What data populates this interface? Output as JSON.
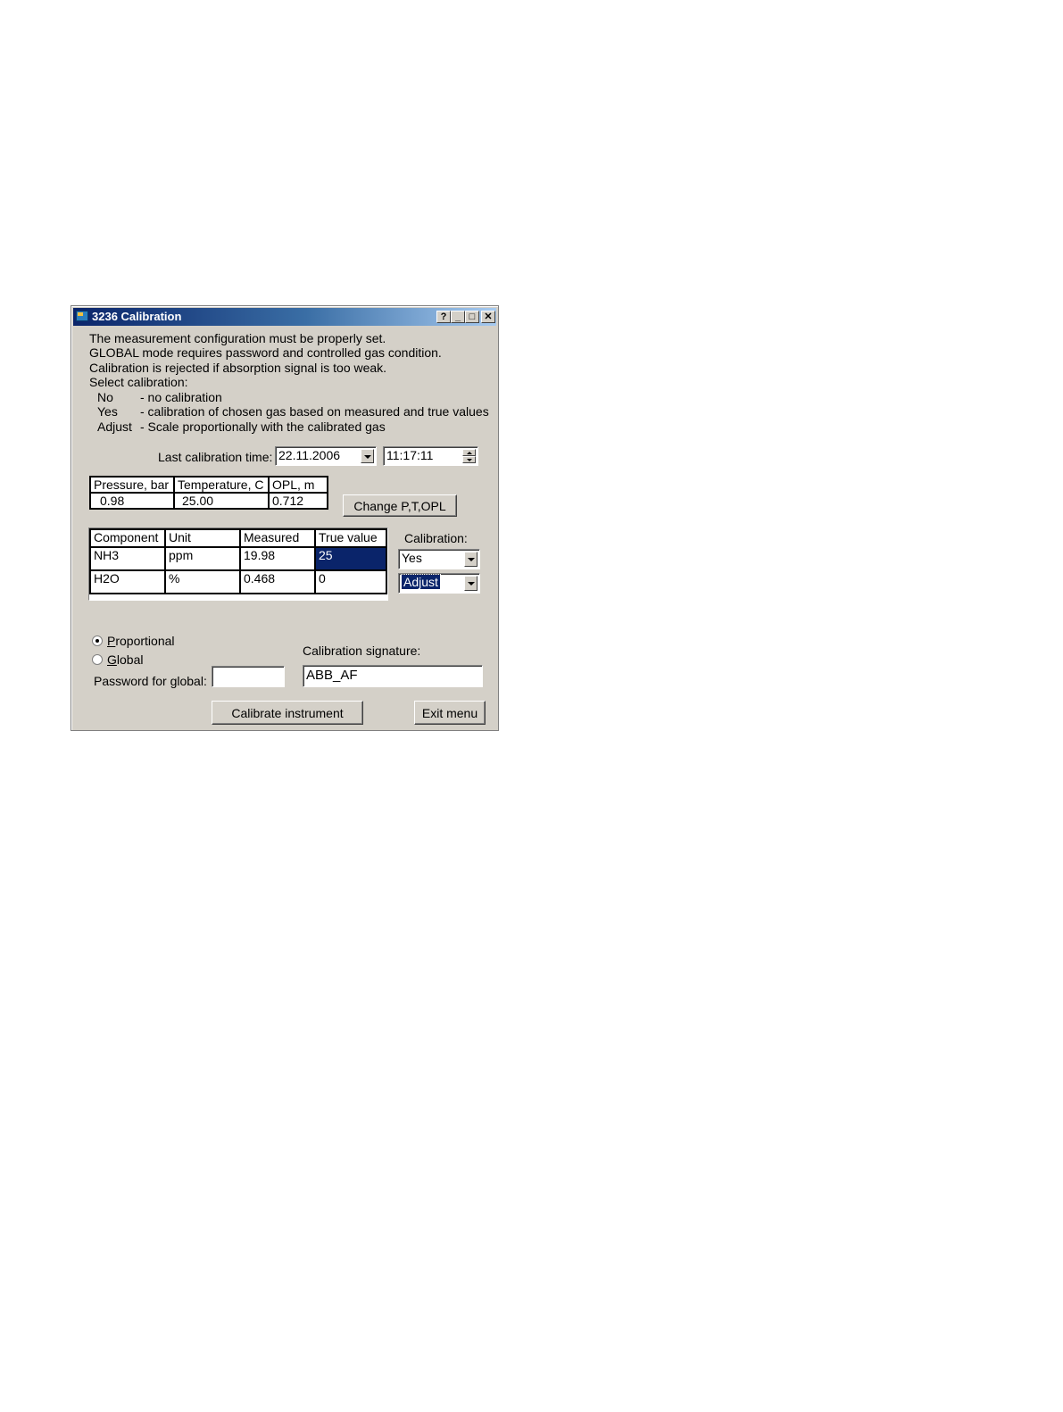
{
  "window": {
    "title": "3236 Calibration"
  },
  "info": {
    "line1": "The measurement configuration must be properly set.",
    "line2": "GLOBAL mode requires password and controlled gas condition.",
    "line3": "Calibration is rejected if absorption signal is too weak.",
    "line4": "Select calibration:",
    "options": [
      {
        "key": "No",
        "desc": "- no calibration"
      },
      {
        "key": "Yes",
        "desc": "- calibration of chosen gas based on measured and true values"
      },
      {
        "key": "Adjust",
        "desc": "- Scale proportionally with the calibrated gas"
      }
    ]
  },
  "last_calibration": {
    "label": "Last calibration time:",
    "date": "22.11.2006",
    "time": "11:17:11"
  },
  "ptopl": {
    "headers": [
      "Pressure, bar",
      "Temperature, C",
      "OPL, m"
    ],
    "values": [
      "0.98",
      "25.00",
      "0.712"
    ],
    "button": "Change P,T,OPL"
  },
  "components": {
    "headers": [
      "Component",
      "Unit",
      "Measured",
      "True value"
    ],
    "rows": [
      {
        "component": "NH3",
        "unit": "ppm",
        "measured": "19.98",
        "true_value": "25",
        "calibration": "Yes"
      },
      {
        "component": "H2O",
        "unit": "%",
        "measured": "0.468",
        "true_value": "0",
        "calibration": "Adjust"
      }
    ],
    "calibration_label": "Calibration:"
  },
  "mode": {
    "proportional_prefix": "P",
    "proportional_rest": "roportional",
    "global_prefix": "G",
    "global_rest": "lobal",
    "selected": "Proportional",
    "password_label": "Password for global:",
    "password_value": ""
  },
  "signature": {
    "label": "Calibration signature:",
    "value": "ABB_AF"
  },
  "actions": {
    "calibrate": "Calibrate instrument",
    "exit": "Exit menu"
  }
}
